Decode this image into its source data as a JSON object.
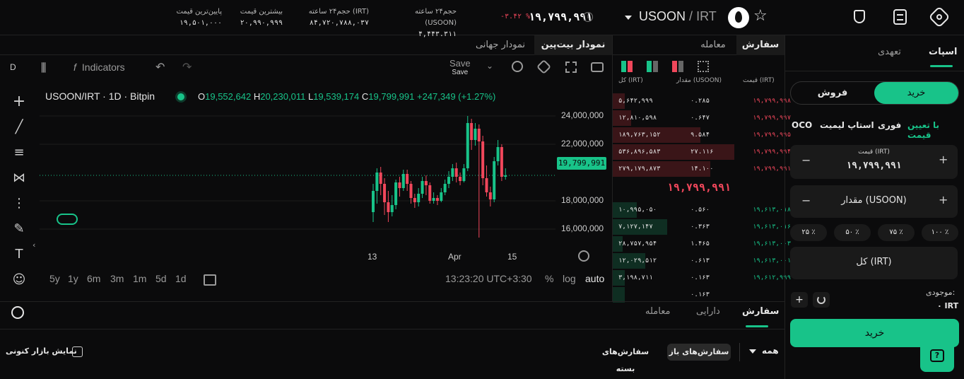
{
  "header": {
    "pair_base": "USOON",
    "pair_sep": "/",
    "pair_quote": "IRT",
    "price": "۱۹,۷۹۹,۹۹۱",
    "change": "-۳.۴۲ %",
    "stats": [
      {
        "label": "حجم۲۴ ساعته (USOON)",
        "value": "۴,۴۴۳.۳۱۱"
      },
      {
        "label": "حجم۲۴ ساعته (IRT)",
        "value": "۸۴,۷۲۰,۷۸۸,۰۳۷"
      },
      {
        "label": "بیشترین قیمت",
        "value": "۲۰,۹۹۰,۹۹۹"
      },
      {
        "label": "پایین‌ترین قیمت",
        "value": "۱۹,۵۰۱,۰۰۰"
      }
    ]
  },
  "tabs_left": {
    "bitpin_chart": "نمودار بیت‌پین",
    "global_chart": "نمودار جهانی"
  },
  "tabs_mid": {
    "order": "سفارش",
    "trade": "معامله"
  },
  "toolbar": {
    "interval": "D",
    "indicators": "Indicators",
    "save": "Save",
    "save_sub": "Save"
  },
  "chart": {
    "symbol": "USOON/IRT · 1D · Bitpin",
    "o_label": "O",
    "o": "19,552,642",
    "h_label": "H",
    "h": "20,230,011",
    "l_label": "L",
    "l": "19,539,174",
    "c_label": "C",
    "c": "19,799,991",
    "chg": "+247,349 (+1.27%)",
    "last_label": "19,799,991",
    "time": "13:23:20 UTC+3:30",
    "pct": "%",
    "log": "log",
    "auto": "auto"
  },
  "timeframes": [
    "5y",
    "1y",
    "6m",
    "3m",
    "1m",
    "5d",
    "1d"
  ],
  "chart_data": {
    "type": "candlestick",
    "y_ticks": [
      "24,000,000",
      "22,000,000",
      "18,000,000",
      "16,000,000"
    ],
    "x_ticks": [
      "13",
      "Apr",
      "15"
    ],
    "ylim": [
      14000000,
      26000000
    ],
    "candles": [
      [
        17200000,
        18700000,
        16500000,
        19200000
      ],
      [
        18700000,
        20000000,
        17800000,
        20300000
      ],
      [
        20000000,
        19200000,
        18400000,
        20400000
      ],
      [
        19200000,
        17900000,
        17000000,
        19600000
      ],
      [
        17900000,
        17200000,
        16500000,
        18700000
      ],
      [
        17200000,
        17700000,
        16900000,
        18400000
      ],
      [
        17700000,
        19300000,
        17400000,
        19500000
      ],
      [
        19300000,
        18900000,
        18300000,
        19700000
      ],
      [
        18900000,
        19900000,
        18700000,
        20200000
      ],
      [
        19900000,
        19200000,
        18700000,
        20200000
      ],
      [
        19200000,
        18200000,
        17800000,
        19400000
      ],
      [
        18200000,
        17900000,
        17500000,
        18500000
      ],
      [
        17900000,
        18500000,
        17600000,
        18900000
      ],
      [
        18500000,
        19400000,
        18200000,
        19700000
      ],
      [
        19400000,
        19100000,
        18400000,
        19800000
      ],
      [
        19100000,
        18000000,
        17800000,
        19300000
      ],
      [
        18000000,
        18200000,
        17800000,
        18600000
      ],
      [
        18200000,
        18000000,
        17700000,
        18400000
      ],
      [
        18000000,
        18600000,
        17900000,
        18900000
      ],
      [
        18600000,
        19200000,
        18400000,
        19500000
      ],
      [
        19200000,
        19700000,
        18900000,
        20100000
      ],
      [
        19700000,
        20300000,
        19400000,
        20600000
      ],
      [
        20300000,
        19700000,
        19300000,
        20700000
      ],
      [
        19700000,
        19400000,
        19100000,
        20000000
      ],
      [
        19400000,
        20300000,
        19300000,
        20600000
      ],
      [
        20300000,
        23500000,
        20100000,
        24000000
      ],
      [
        23500000,
        22300000,
        21600000,
        23800000
      ],
      [
        22300000,
        23100000,
        21900000,
        23500000
      ],
      [
        23100000,
        22200000,
        15400000,
        23400000
      ],
      [
        22200000,
        19600000,
        19100000,
        22600000
      ],
      [
        19600000,
        18600000,
        18300000,
        20500000
      ],
      [
        18600000,
        18100000,
        17600000,
        19000000
      ],
      [
        18100000,
        20800000,
        17900000,
        21100000
      ],
      [
        20800000,
        21800000,
        20500000,
        22300000
      ],
      [
        21800000,
        19700000,
        19400000,
        22000000
      ],
      [
        19700000,
        19800000,
        19500000,
        20300000
      ]
    ],
    "colors": {
      "up": "#18c389",
      "down": "#f0475b"
    }
  },
  "orderbook": {
    "headers": {
      "price": "قیمت (IRT)",
      "amount": "مقدار (USOON)",
      "total": "کل (IRT)"
    },
    "asks": [
      {
        "price": "۱۹,۷۹۹,۹۹۸",
        "amount": "۰.۲۸۵",
        "total": "۵,۶۴۲,۹۹۹",
        "depth": 0.1
      },
      {
        "price": "۱۹,۷۹۹,۹۹۷",
        "amount": "۰.۶۴۷",
        "total": "۱۲,۸۱۰,۵۹۸",
        "depth": 0.15
      },
      {
        "price": "۱۹,۷۹۹,۹۹۵",
        "amount": "۹.۵۸۴",
        "total": "۱۸۹,۷۶۳,۱۵۲",
        "depth": 0.72
      },
      {
        "price": "۱۹,۷۹۹,۹۹۴",
        "amount": "۲۷.۱۱۶",
        "total": "۵۳۶,۸۹۶,۵۸۳",
        "depth": 1.0
      },
      {
        "price": "۱۹,۷۹۹,۹۹۱",
        "amount": "۱۴.۱۰۰",
        "total": "۲۷۹,۱۷۹,۸۷۳",
        "depth": 0.8
      }
    ],
    "mid": "۱۹,۷۹۹,۹۹۱",
    "bids": [
      {
        "price": "۱۹,۶۱۳,۰۱۸",
        "amount": "۰.۵۶۰",
        "total": "۱۰,۹۹۵,۰۵۰",
        "depth": 0.2
      },
      {
        "price": "۱۹,۶۱۳,۰۱۶",
        "amount": "۰.۳۶۳",
        "total": "۷,۱۲۷,۱۴۷",
        "depth": 0.45
      },
      {
        "price": "۱۹,۶۱۳,۰۰۳",
        "amount": "۱.۴۶۵",
        "total": "۲۸,۷۵۷,۹۵۴",
        "depth": 0.08
      },
      {
        "price": "۱۹,۶۱۳,۰۰۱",
        "amount": "۰.۶۱۳",
        "total": "۱۲,۰۲۹,۵۱۲",
        "depth": 0.27
      },
      {
        "price": "۱۹,۶۱۲,۹۹۹",
        "amount": "۰.۱۶۳",
        "total": "۳,۱۹۸,۷۱۱",
        "depth": 0.1
      },
      {
        "price": "",
        "amount": "۰.۱۶۳",
        "total": "",
        "depth": 0.1
      }
    ]
  },
  "side": {
    "spot": "اسپات",
    "margin": "تعهدی",
    "buy": "خرید",
    "sell": "فروش",
    "order_types": [
      "با تعیین قیمت",
      "فوری",
      "استاپ لیمیت",
      "OCO"
    ],
    "price_label": "قیمت (IRT)",
    "price_value": "۱۹,۷۹۹,۹۹۱",
    "amount_label": "مقدار (USOON)",
    "pcts": [
      "۱۰۰ ٪",
      "۷۵ ٪",
      "۵۰ ٪",
      "۲۵ ٪"
    ],
    "total_label": "کل (IRT)",
    "balance_label": "موجودی:",
    "balance_value": "۰ IRT",
    "buy_button": "خرید",
    "minus": "−",
    "plus": "+"
  },
  "bottom": {
    "tabs": [
      "سفارش",
      "دارایی",
      "معامله"
    ],
    "filter": "همه",
    "open_orders": "سفارش‌های باز",
    "closed_orders": "سفارش‌های بسته",
    "show_market": "نمایش بازار کنونی"
  }
}
